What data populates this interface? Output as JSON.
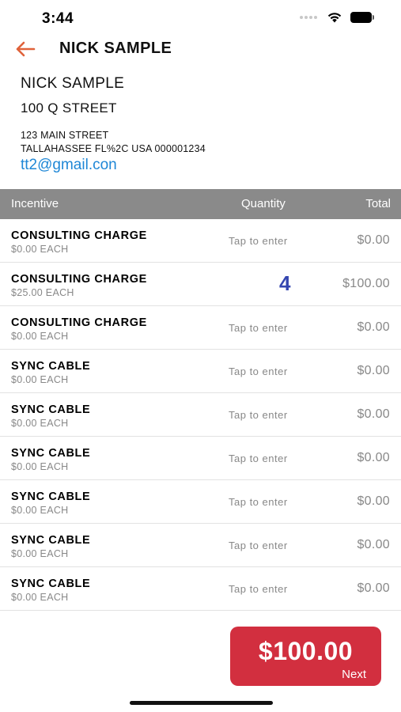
{
  "status_bar": {
    "time": "3:44"
  },
  "nav": {
    "title": "NICK SAMPLE"
  },
  "customer": {
    "name": "NICK SAMPLE",
    "line2": "100 Q STREET",
    "address1": "123 MAIN STREET",
    "address2": "TALLAHASSEE FL%2C USA 000001234",
    "email": "tt2@gmail.con"
  },
  "table": {
    "headers": {
      "incentive": "Incentive",
      "quantity": "Quantity",
      "total": "Total"
    },
    "rows": [
      {
        "title": "CONSULTING CHARGE",
        "price": "$0.00 EACH",
        "quantity": "Tap to enter",
        "total": "$0.00"
      },
      {
        "title": "CONSULTING CHARGE",
        "price": "$25.00 EACH",
        "quantity": "4",
        "total": "$100.00"
      },
      {
        "title": "CONSULTING CHARGE",
        "price": "$0.00 EACH",
        "quantity": "Tap to enter",
        "total": "$0.00"
      },
      {
        "title": "SYNC CABLE",
        "price": "$0.00 EACH",
        "quantity": "Tap to enter",
        "total": "$0.00"
      },
      {
        "title": "SYNC CABLE",
        "price": "$0.00 EACH",
        "quantity": "Tap to enter",
        "total": "$0.00"
      },
      {
        "title": "SYNC CABLE",
        "price": "$0.00 EACH",
        "quantity": "Tap to enter",
        "total": "$0.00"
      },
      {
        "title": "SYNC CABLE",
        "price": "$0.00 EACH",
        "quantity": "Tap to enter",
        "total": "$0.00"
      },
      {
        "title": "SYNC CABLE",
        "price": "$0.00 EACH",
        "quantity": "Tap to enter",
        "total": "$0.00"
      },
      {
        "title": "SYNC CABLE",
        "price": "$0.00 EACH",
        "quantity": "Tap to enter",
        "total": "$0.00"
      }
    ]
  },
  "footer": {
    "total": "$100.00",
    "next_label": "Next"
  },
  "colors": {
    "accent_back": "#e0623a",
    "next_button": "#d22f3f",
    "email_link": "#1f87d6",
    "quantity_value": "#3546b0",
    "header_bg": "#8a8a8a"
  },
  "icons": {
    "back": "arrow-left-icon",
    "wifi": "wifi-icon",
    "battery": "battery-icon",
    "signal": "signal-icon"
  }
}
